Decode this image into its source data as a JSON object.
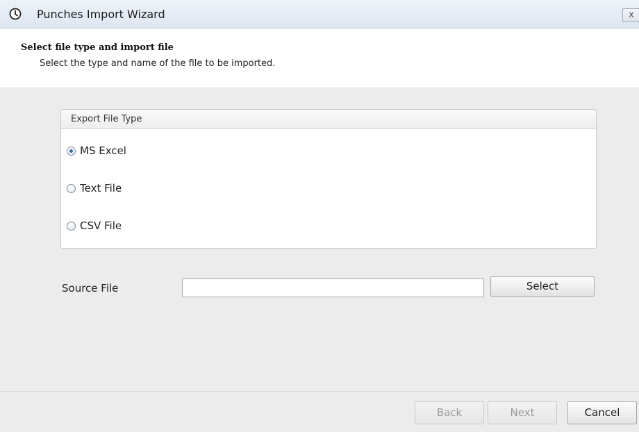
{
  "window": {
    "title": "Punches Import Wizard",
    "close_label": "x"
  },
  "header": {
    "title": "Select file type and import file",
    "subtitle": "Select the type and name of the file to be imported."
  },
  "export_file_type": {
    "group_title": "Export File Type",
    "selected": "MS Excel",
    "options": [
      {
        "label": "MS Excel",
        "checked": true
      },
      {
        "label": "Text File",
        "checked": false
      },
      {
        "label": "CSV File",
        "checked": false
      }
    ]
  },
  "source_file": {
    "label": "Source File",
    "value": "",
    "select_label": "Select"
  },
  "footer": {
    "back_label": "Back",
    "back_enabled": false,
    "next_label": "Next",
    "next_enabled": false,
    "cancel_label": "Cancel",
    "cancel_enabled": true
  },
  "icons": {
    "app": "clock-icon",
    "close": "close-icon"
  }
}
